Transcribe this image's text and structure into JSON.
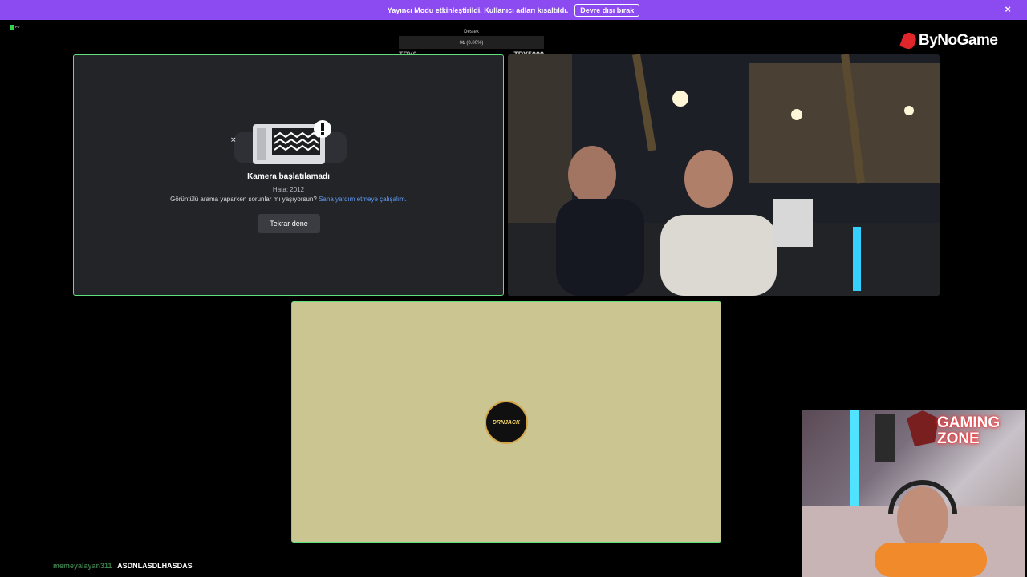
{
  "banner": {
    "message": "Yayıncı Modu etkinleştirildi. Kullanıcı adları kısaltıldı.",
    "disable_label": "Devre dışı bırak",
    "close_glyph": "×",
    "color": "#8c4bf0"
  },
  "live_indicator": {
    "text": "ᴘᴅ"
  },
  "donation_goal": {
    "title": "Destek",
    "progress_text": "0₺ (0.00%)",
    "progress_fraction": 0.0,
    "start_label": "TRY0",
    "end_label": "TRY5000"
  },
  "brand": {
    "name": "ByNoGame",
    "logo_color": "#e0262b"
  },
  "camera_error": {
    "title": "Kamera başlatılamadı",
    "code": "Hata: 2012",
    "help_text": "Görüntülü arama yaparken sorunlar mı yaşıyorsun?",
    "help_link": "Sana yardım etmeye çalışalım.",
    "retry_label": "Tekrar dene",
    "border_color": "#5fe07b"
  },
  "avatar_tile": {
    "avatar_text": "DRNJACK",
    "background": "#cbc691"
  },
  "overlay": {
    "neon_text_line1": "GAMING",
    "neon_text_line2": "ZONE"
  },
  "chat": {
    "username": "memeyalayan311",
    "message": "ASDNLASDLHASDAS"
  }
}
